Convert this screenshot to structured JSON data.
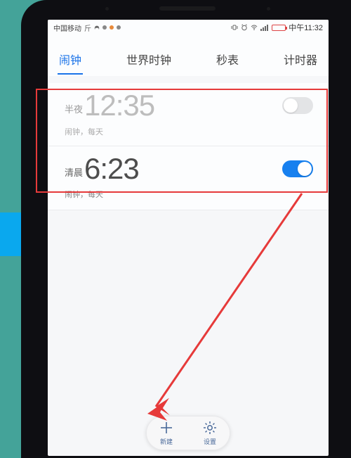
{
  "status": {
    "carrier": "中国移动",
    "hfn": "斤",
    "time_label": "中午11:32"
  },
  "tabs": {
    "alarm": "闹钟",
    "world": "世界时钟",
    "stopwatch": "秒表",
    "timer": "计时器"
  },
  "alarms": {
    "row0": {
      "ampm": "半夜",
      "time": "12:35",
      "sub": "闹钟，每天",
      "enabled": false
    },
    "row1": {
      "ampm": "清晨",
      "time": "6:23",
      "sub": "闹钟，每天",
      "enabled": true
    }
  },
  "bottom": {
    "new": "新建",
    "settings": "设置"
  }
}
